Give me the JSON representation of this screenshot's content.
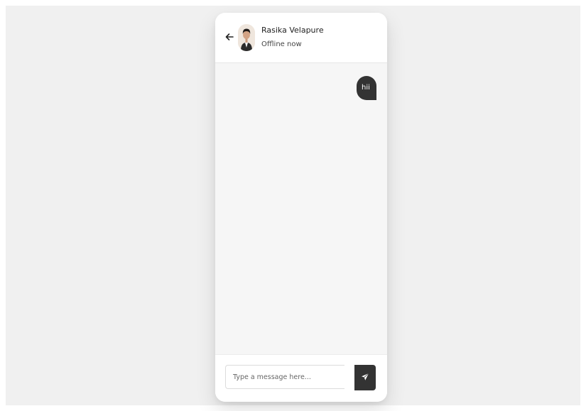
{
  "chat": {
    "contact_name": "Rasika Velapure",
    "contact_status": "Offline now",
    "messages": [
      {
        "direction": "outgoing",
        "text": "hii"
      }
    ],
    "input": {
      "placeholder": "Type a message here...",
      "value": ""
    }
  },
  "icons": {
    "back": "arrow-left-icon",
    "send": "paper-plane-icon",
    "avatar": "profile-photo"
  },
  "colors": {
    "page_background": "#f0f0f0",
    "card_background": "#ffffff",
    "chat_background": "#f6f6f6",
    "bubble_outgoing": "#333333",
    "send_button": "#333333"
  }
}
